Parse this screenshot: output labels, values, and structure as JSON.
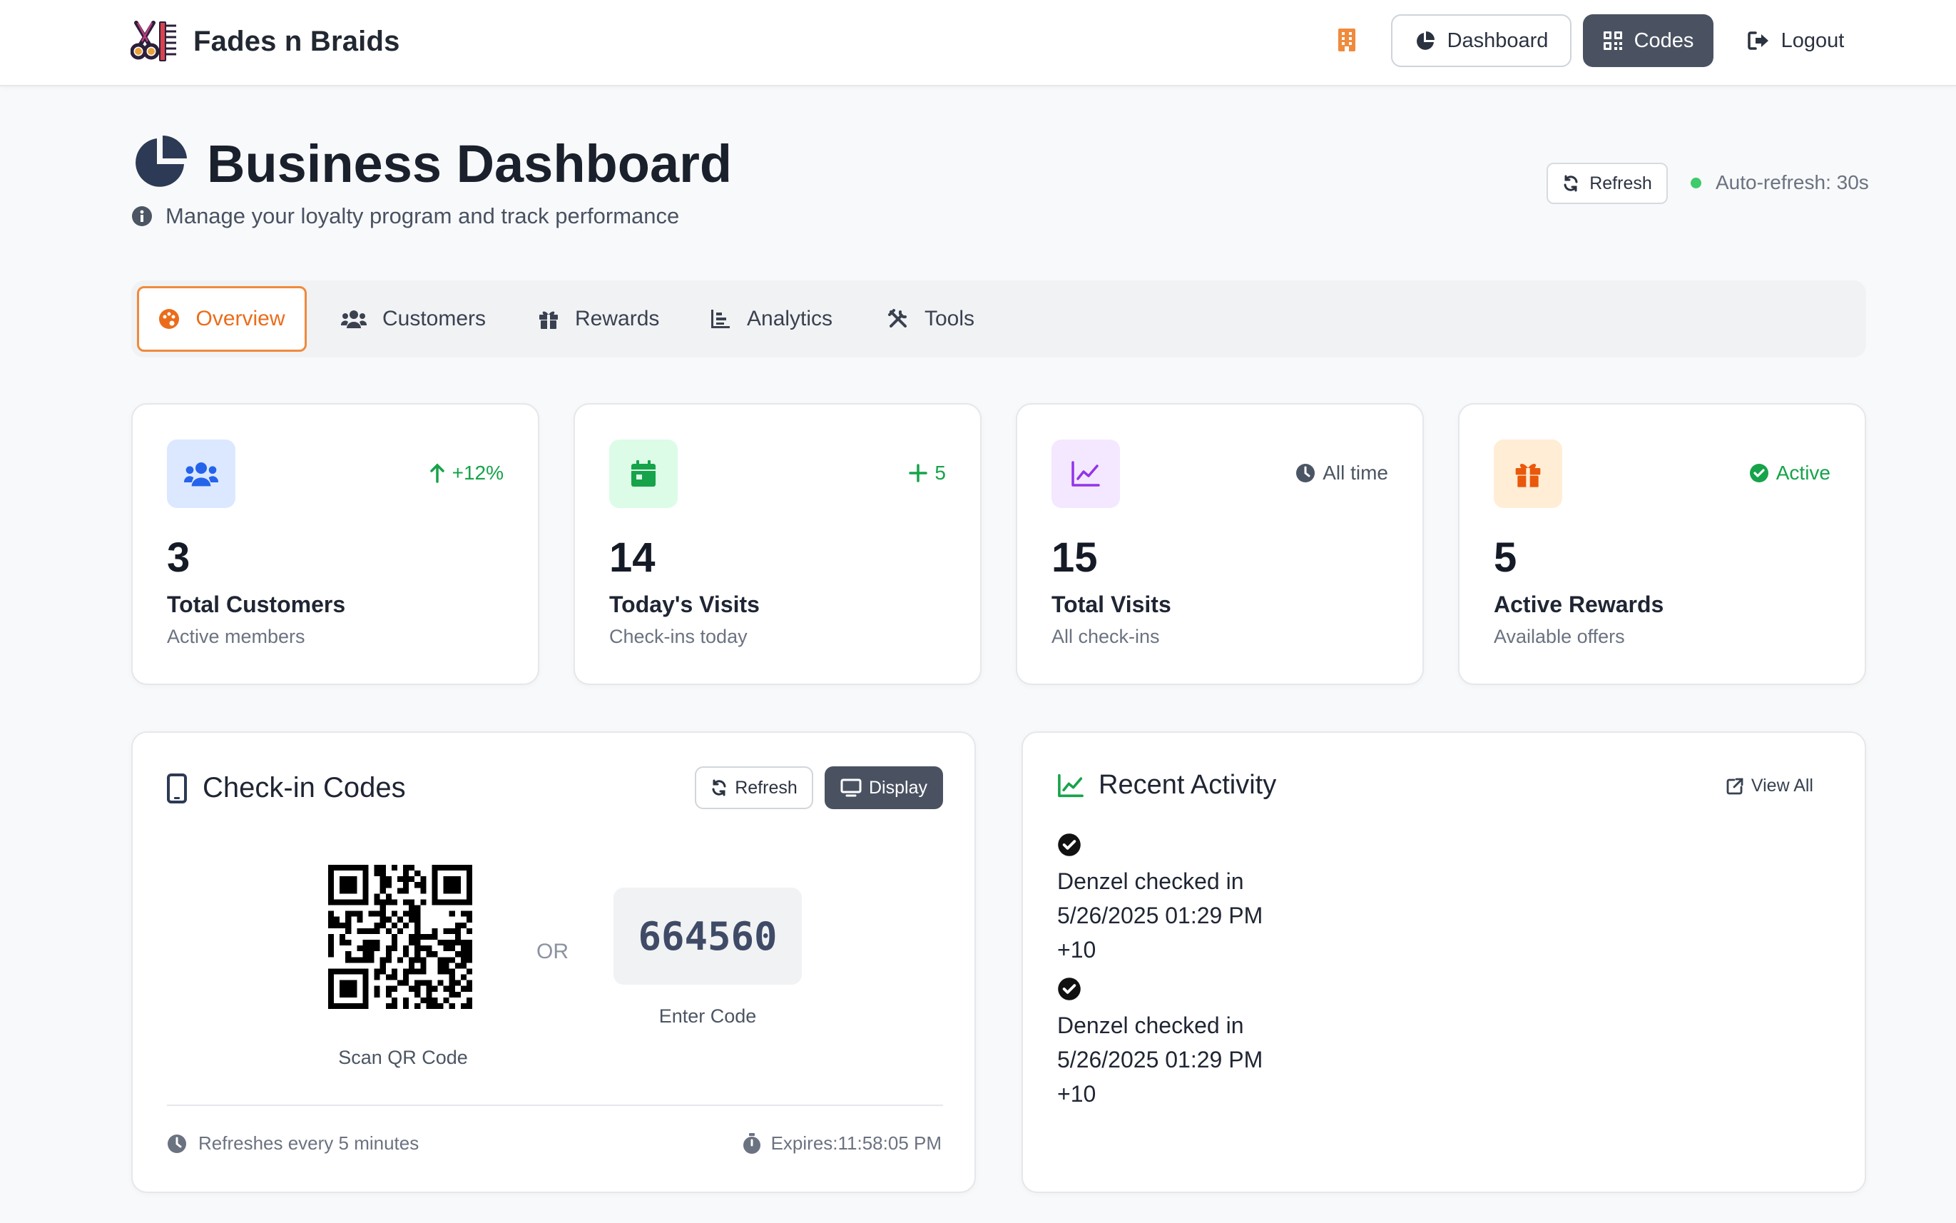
{
  "navbar": {
    "brand": "Fades n Braids",
    "dashboard_label": "Dashboard",
    "codes_label": "Codes",
    "logout_label": "Logout"
  },
  "header": {
    "title": "Business Dashboard",
    "subtitle": "Manage your loyalty program and track performance",
    "refresh_label": "Refresh",
    "auto_refresh": "Auto-refresh: 30s"
  },
  "tabs": [
    {
      "label": "Overview",
      "icon": "palette-icon",
      "active": true
    },
    {
      "label": "Customers",
      "icon": "users-icon"
    },
    {
      "label": "Rewards",
      "icon": "gift-icon"
    },
    {
      "label": "Analytics",
      "icon": "chart-bar-icon"
    },
    {
      "label": "Tools",
      "icon": "tools-icon"
    }
  ],
  "stats": [
    {
      "value": "3",
      "label": "Total Customers",
      "sub": "Active members",
      "badge": "+12%",
      "icon": "users-icon",
      "color": "#2563eb",
      "bg": "#dbe8ff"
    },
    {
      "value": "14",
      "label": "Today's Visits",
      "sub": "Check-ins today",
      "badge": "5",
      "icon": "calendar-icon",
      "color": "#16a34a",
      "bg": "#dcfce7"
    },
    {
      "value": "15",
      "label": "Total Visits",
      "sub": "All check-ins",
      "badge": "All time",
      "icon": "line-chart-icon",
      "color": "#9333ea",
      "bg": "#f3e8ff"
    },
    {
      "value": "5",
      "label": "Active Rewards",
      "sub": "Available offers",
      "badge": "Active",
      "icon": "gift-icon",
      "color": "#ea580c",
      "bg": "#ffedd5"
    }
  ],
  "checkin": {
    "title": "Check-in Codes",
    "refresh_label": "Refresh",
    "display_label": "Display",
    "qr_caption": "Scan QR Code",
    "or_label": "OR",
    "code": "664560",
    "code_caption": "Enter Code",
    "refresh_note": "Refreshes every 5 minutes",
    "expires": "Expires:11:58:05 PM"
  },
  "activity": {
    "title": "Recent Activity",
    "view_all": "View All",
    "items": [
      {
        "text": "Denzel checked in",
        "time": "5/26/2025 01:29 PM",
        "points": "+10"
      },
      {
        "text": "Denzel checked in",
        "time": "5/26/2025 01:29 PM",
        "points": "+10"
      }
    ]
  },
  "colors": {
    "accent": "#ea6c1a",
    "dark_button": "#4a5262",
    "success": "#16a34a"
  }
}
